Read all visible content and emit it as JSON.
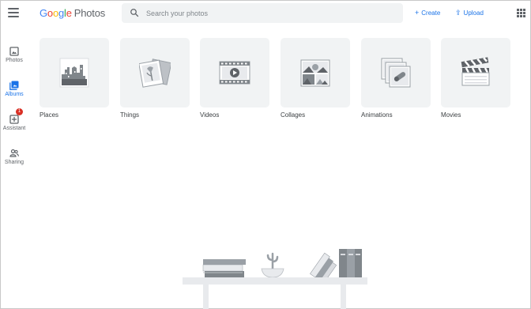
{
  "header": {
    "logo": {
      "brand": "Google",
      "product": "Photos"
    },
    "search_placeholder": "Search your photos",
    "create_label": "Create",
    "upload_label": "Upload"
  },
  "sidebar": {
    "items": [
      {
        "label": "Photos",
        "icon": "photo-icon"
      },
      {
        "label": "Albums",
        "icon": "albums-icon",
        "active": true
      },
      {
        "label": "Assistant",
        "icon": "assistant-icon",
        "badge": "1"
      },
      {
        "label": "Sharing",
        "icon": "sharing-icon"
      }
    ]
  },
  "categories": [
    {
      "label": "Places",
      "icon": "places-icon"
    },
    {
      "label": "Things",
      "icon": "things-icon"
    },
    {
      "label": "Videos",
      "icon": "videos-icon"
    },
    {
      "label": "Collages",
      "icon": "collages-icon"
    },
    {
      "label": "Animations",
      "icon": "animations-icon"
    },
    {
      "label": "Movies",
      "icon": "movies-icon"
    }
  ],
  "colors": {
    "accent": "#1a73e8",
    "card_bg": "#f1f3f4",
    "badge": "#d93025",
    "icon_gray": "#5f6368"
  }
}
